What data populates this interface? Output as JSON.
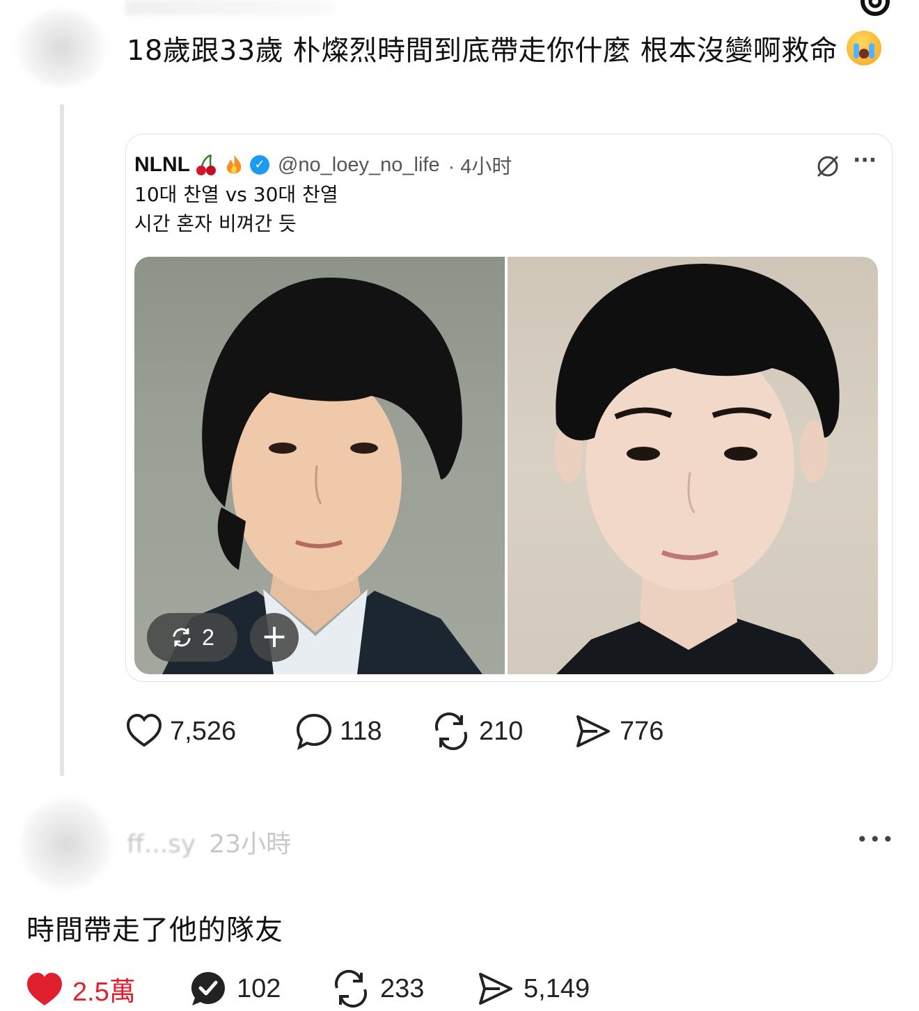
{
  "post": {
    "text": "18歲跟33歲 朴燦烈時間到底帶走你什麼 根本沒變啊救命",
    "stats": {
      "likes": "7,526",
      "replies": "118",
      "reposts": "210",
      "shares": "776"
    }
  },
  "quoted_tweet": {
    "name": "NLNL",
    "handle": "@no_loey_no_life",
    "time": "· 4小时",
    "line1": "10대 찬열 vs 30대 찬열",
    "line2": "시간 혼자 비껴간 듯",
    "repost_count": "2",
    "add_symbol": "+",
    "more_symbol": "···"
  },
  "reply": {
    "name": "ff...sy",
    "time": "23小時",
    "text": "時間帶走了他的隊友",
    "more_symbol": "•••",
    "stats": {
      "likes": "2.5萬",
      "replies": "102",
      "reposts": "233",
      "shares": "5,149"
    }
  },
  "colors": {
    "like_active": "#e0202e",
    "verified": "#1d9bf0"
  },
  "icons": [
    "threads-logo-icon",
    "crying-emoji-icon",
    "cherry-icon",
    "fire-icon",
    "verified-badge-icon",
    "grok-icon",
    "more-icon",
    "repost-icon",
    "plus-icon",
    "heart-icon",
    "comment-icon",
    "share-icon",
    "check-comment-icon"
  ]
}
